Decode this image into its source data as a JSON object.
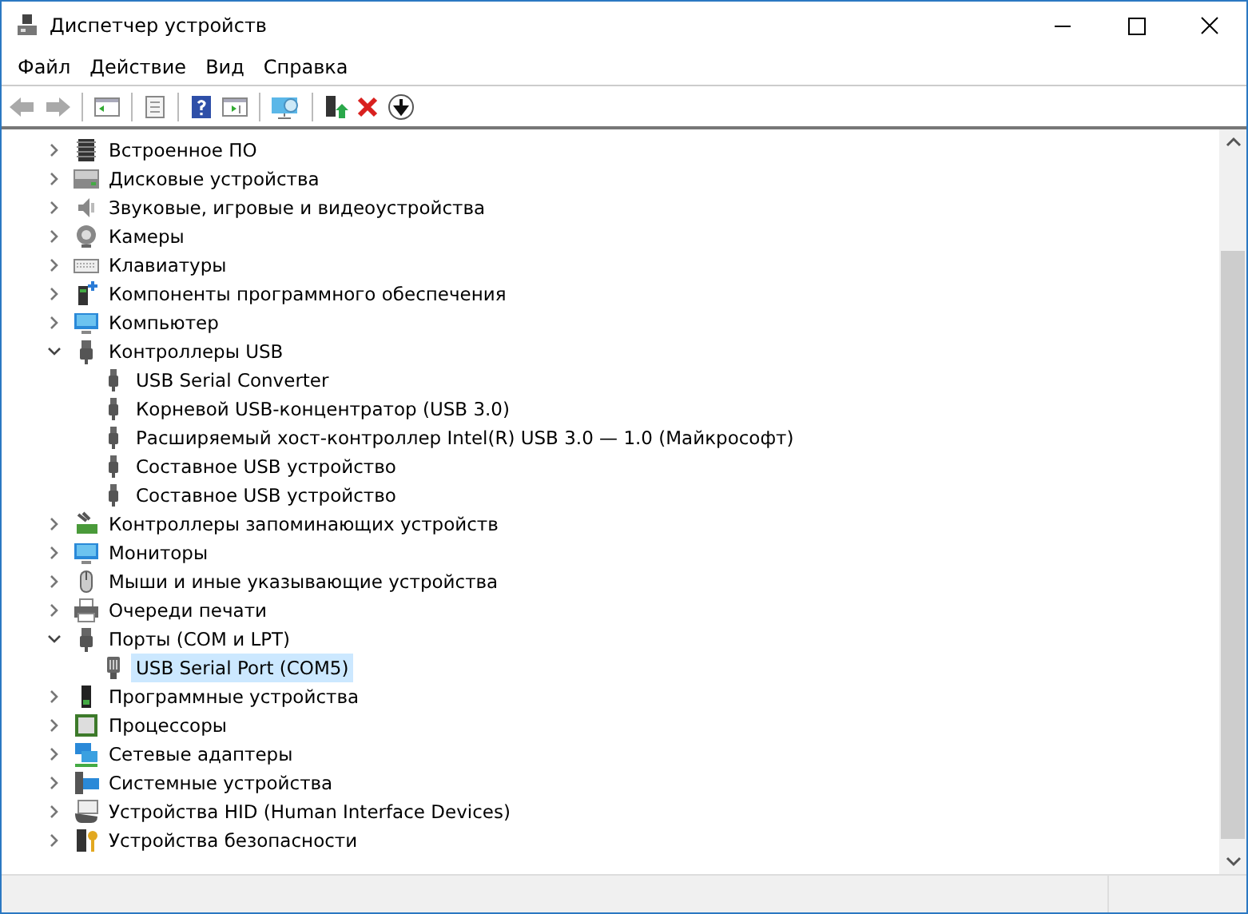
{
  "window": {
    "title": "Диспетчер устройств"
  },
  "menu": [
    {
      "label": "Файл"
    },
    {
      "label": "Действие"
    },
    {
      "label": "Вид"
    },
    {
      "label": "Справка"
    }
  ],
  "tree": {
    "items": [
      {
        "label": "Встроенное ПО",
        "expanded": false,
        "selected": false
      },
      {
        "label": "Дисковые устройства",
        "expanded": false,
        "selected": false
      },
      {
        "label": "Звуковые, игровые и видеоустройства",
        "expanded": false,
        "selected": false
      },
      {
        "label": "Камеры",
        "expanded": false,
        "selected": false
      },
      {
        "label": "Клавиатуры",
        "expanded": false,
        "selected": false
      },
      {
        "label": "Компоненты программного обеспечения",
        "expanded": false,
        "selected": false
      },
      {
        "label": "Компьютер",
        "expanded": false,
        "selected": false
      },
      {
        "label": "Контроллеры USB",
        "expanded": true,
        "selected": false,
        "children": [
          {
            "label": "USB Serial Converter",
            "selected": false
          },
          {
            "label": "Корневой USB-концентратор (USB 3.0)",
            "selected": false
          },
          {
            "label": "Расширяемый хост-контроллер Intel(R) USB 3.0 — 1.0 (Майкрософт)",
            "selected": false
          },
          {
            "label": "Составное USB устройство",
            "selected": false
          },
          {
            "label": "Составное USB устройство",
            "selected": false
          }
        ]
      },
      {
        "label": "Контроллеры запоминающих устройств",
        "expanded": false,
        "selected": false
      },
      {
        "label": "Мониторы",
        "expanded": false,
        "selected": false
      },
      {
        "label": "Мыши и иные указывающие устройства",
        "expanded": false,
        "selected": false
      },
      {
        "label": "Очереди печати",
        "expanded": false,
        "selected": false
      },
      {
        "label": "Порты (COM и LPT)",
        "expanded": true,
        "selected": false,
        "children": [
          {
            "label": "USB Serial Port (COM5)",
            "selected": true
          }
        ]
      },
      {
        "label": "Программные устройства",
        "expanded": false,
        "selected": false
      },
      {
        "label": "Процессоры",
        "expanded": false,
        "selected": false
      },
      {
        "label": "Сетевые адаптеры",
        "expanded": false,
        "selected": false
      },
      {
        "label": "Системные устройства",
        "expanded": false,
        "selected": false
      },
      {
        "label": "Устройства HID (Human Interface Devices)",
        "expanded": false,
        "selected": false
      },
      {
        "label": "Устройства безопасности",
        "expanded": false,
        "selected": false
      }
    ]
  }
}
